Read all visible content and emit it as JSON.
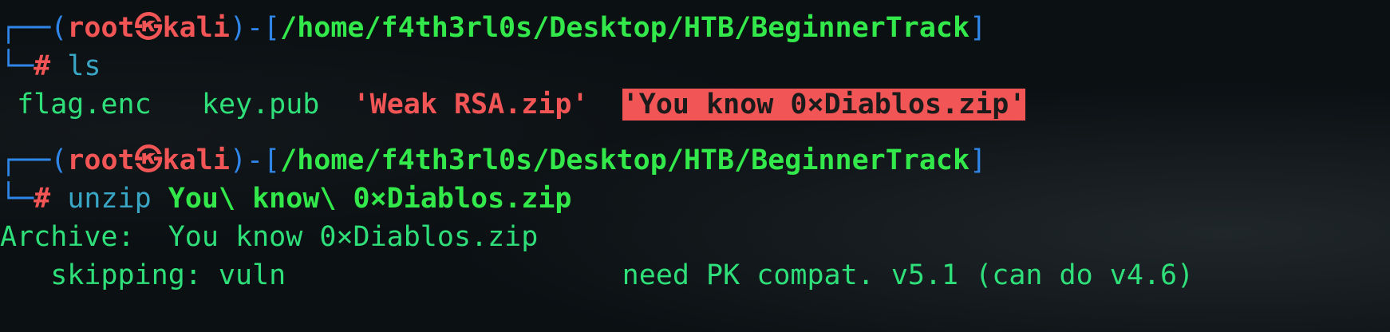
{
  "prompt1": {
    "corner_top": "┌──(",
    "user": "root",
    "at_icon": "㉿",
    "host": "kali",
    "sep": ")-[",
    "path": "/home/f4th3rl0s/Desktop/HTB/BeginnerTrack",
    "close": "]",
    "corner_bottom": "└─",
    "hash": "#",
    "command": "ls"
  },
  "ls_output": {
    "file1": "flag.enc",
    "file2": "key.pub",
    "file3": "'Weak RSA.zip'",
    "file4": "'You know 0×Diablos.zip'"
  },
  "prompt2": {
    "corner_top": "┌──(",
    "user": "root",
    "at_icon": "㉿",
    "host": "kali",
    "sep": ")-[",
    "path": "/home/f4th3rl0s/Desktop/HTB/BeginnerTrack",
    "close": "]",
    "corner_bottom": "└─",
    "hash": "#",
    "command": "unzip",
    "argument": "You\\ know\\ 0×Diablos.zip"
  },
  "unzip_output": {
    "archive_label": "Archive:",
    "archive_name": "You know 0×Diablos.zip",
    "skip_label": "skipping: vuln",
    "skip_reason": "need PK compat. v5.1 (can do v4.6)"
  },
  "colors": {
    "blue": "#2f86e8",
    "red": "#f25555",
    "green": "#32e84a",
    "cyan": "#3aa6c6"
  }
}
